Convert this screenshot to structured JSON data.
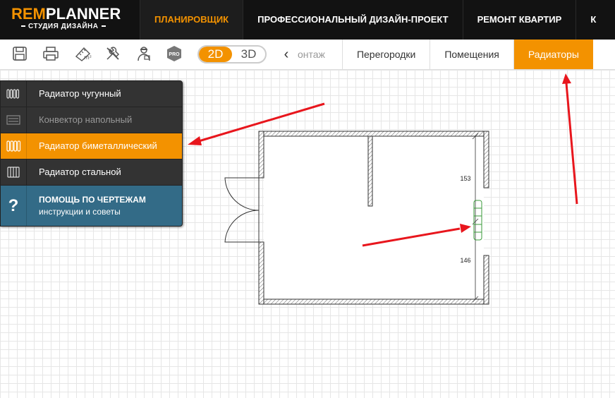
{
  "logo": {
    "brand_rem": "REM",
    "brand_planner": "PLANNER",
    "subtitle": "СТУДИЯ ДИЗАЙНА"
  },
  "topnav": [
    {
      "label": "ПЛАНИРОВЩИК",
      "active": true
    },
    {
      "label": "ПРОФЕССИОНАЛЬНЫЙ ДИЗАЙН-ПРОЕКТ"
    },
    {
      "label": "РЕМОНТ КВАРТИР"
    },
    {
      "label": "К"
    }
  ],
  "toolbar": {
    "icons": [
      "save-icon",
      "print-icon",
      "area-m2-icon",
      "tools-icon",
      "worker-icon",
      "pro-icon"
    ],
    "pro_label": "PRO",
    "mode_2d": "2D",
    "mode_3d": "3D",
    "active_mode": "2D"
  },
  "tabs": [
    {
      "label": "онтаж",
      "faded": true
    },
    {
      "label": "Перегородки"
    },
    {
      "label": "Помещения"
    },
    {
      "label": "Радиаторы",
      "active": true
    }
  ],
  "menu": {
    "items": [
      {
        "label": "Радиатор чугунный"
      },
      {
        "label": "Конвектор напольный",
        "disabled": true
      },
      {
        "label": "Радиатор биметаллический",
        "active": true
      },
      {
        "label": "Радиатор стальной"
      }
    ],
    "help_title": "ПОМОЩЬ ПО ЧЕРТЕЖАМ",
    "help_subtitle": "инструкции и советы"
  },
  "plan": {
    "dim_top": "153",
    "dim_bottom": "146"
  },
  "colors": {
    "accent": "#f39200",
    "topbar": "#121212",
    "menu": "#333333",
    "help": "#336b87",
    "arrow": "#e8161d",
    "radiator": "#3a9a3a"
  }
}
